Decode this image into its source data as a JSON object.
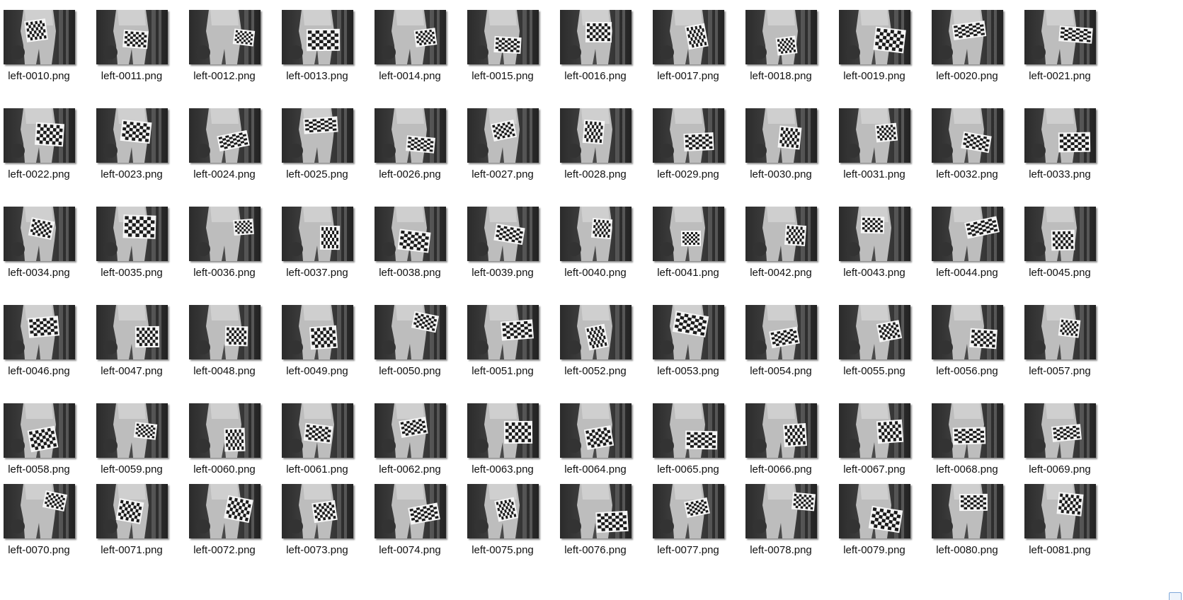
{
  "window": {
    "view": "large-icons",
    "files": [
      "left-0010.png",
      "left-0011.png",
      "left-0012.png",
      "left-0013.png",
      "left-0014.png",
      "left-0015.png",
      "left-0016.png",
      "left-0017.png",
      "left-0018.png",
      "left-0019.png",
      "left-0020.png",
      "left-0021.png",
      "left-0022.png",
      "left-0023.png",
      "left-0024.png",
      "left-0025.png",
      "left-0026.png",
      "left-0027.png",
      "left-0028.png",
      "left-0029.png",
      "left-0030.png",
      "left-0031.png",
      "left-0032.png",
      "left-0033.png",
      "left-0034.png",
      "left-0035.png",
      "left-0036.png",
      "left-0037.png",
      "left-0038.png",
      "left-0039.png",
      "left-0040.png",
      "left-0041.png",
      "left-0042.png",
      "left-0043.png",
      "left-0044.png",
      "left-0045.png",
      "left-0046.png",
      "left-0047.png",
      "left-0048.png",
      "left-0049.png",
      "left-0050.png",
      "left-0051.png",
      "left-0052.png",
      "left-0053.png",
      "left-0054.png",
      "left-0055.png",
      "left-0056.png",
      "left-0057.png",
      "left-0058.png",
      "left-0059.png",
      "left-0060.png",
      "left-0061.png",
      "left-0062.png",
      "left-0063.png",
      "left-0064.png",
      "left-0065.png",
      "left-0066.png",
      "left-0067.png",
      "left-0068.png",
      "left-0069.png",
      "left-0070.png",
      "left-0071.png",
      "left-0072.png",
      "left-0073.png",
      "left-0074.png",
      "left-0075.png",
      "left-0076.png",
      "left-0077.png",
      "left-0078.png",
      "left-0079.png",
      "left-0080.png",
      "left-0081.png"
    ]
  },
  "thumbnail_icon": "grayscale-checkerboard-photo",
  "colors": {
    "background": "#ffffff",
    "label_text": "#111111"
  }
}
